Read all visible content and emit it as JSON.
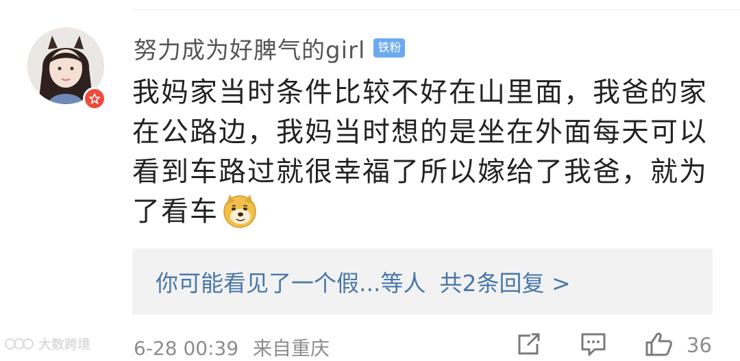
{
  "comment": {
    "username": "努力成为好脾气的girl",
    "fan_badge": "铁粉",
    "text": "我妈家当时条件比较不好在山里面，我爸的家在公路边，我妈当时想的是坐在外面每天可以看到车路过就很幸福了所以嫁给了我爸，就为了看车",
    "emoji": "doge-emoji"
  },
  "replies": {
    "preview": "你可能看见了一个假...等人",
    "count_label": "共2条回复 >"
  },
  "meta": {
    "time": "6-28 00:39",
    "source": "来自重庆",
    "like_count": "36"
  },
  "watermark": {
    "text": "大数跨境"
  },
  "colors": {
    "link_blue": "#4a77a8",
    "fan_badge_bg": "#6da9f0",
    "vip_badge_red": "#ee4b3c",
    "meta_gray": "#8c8c8c"
  }
}
